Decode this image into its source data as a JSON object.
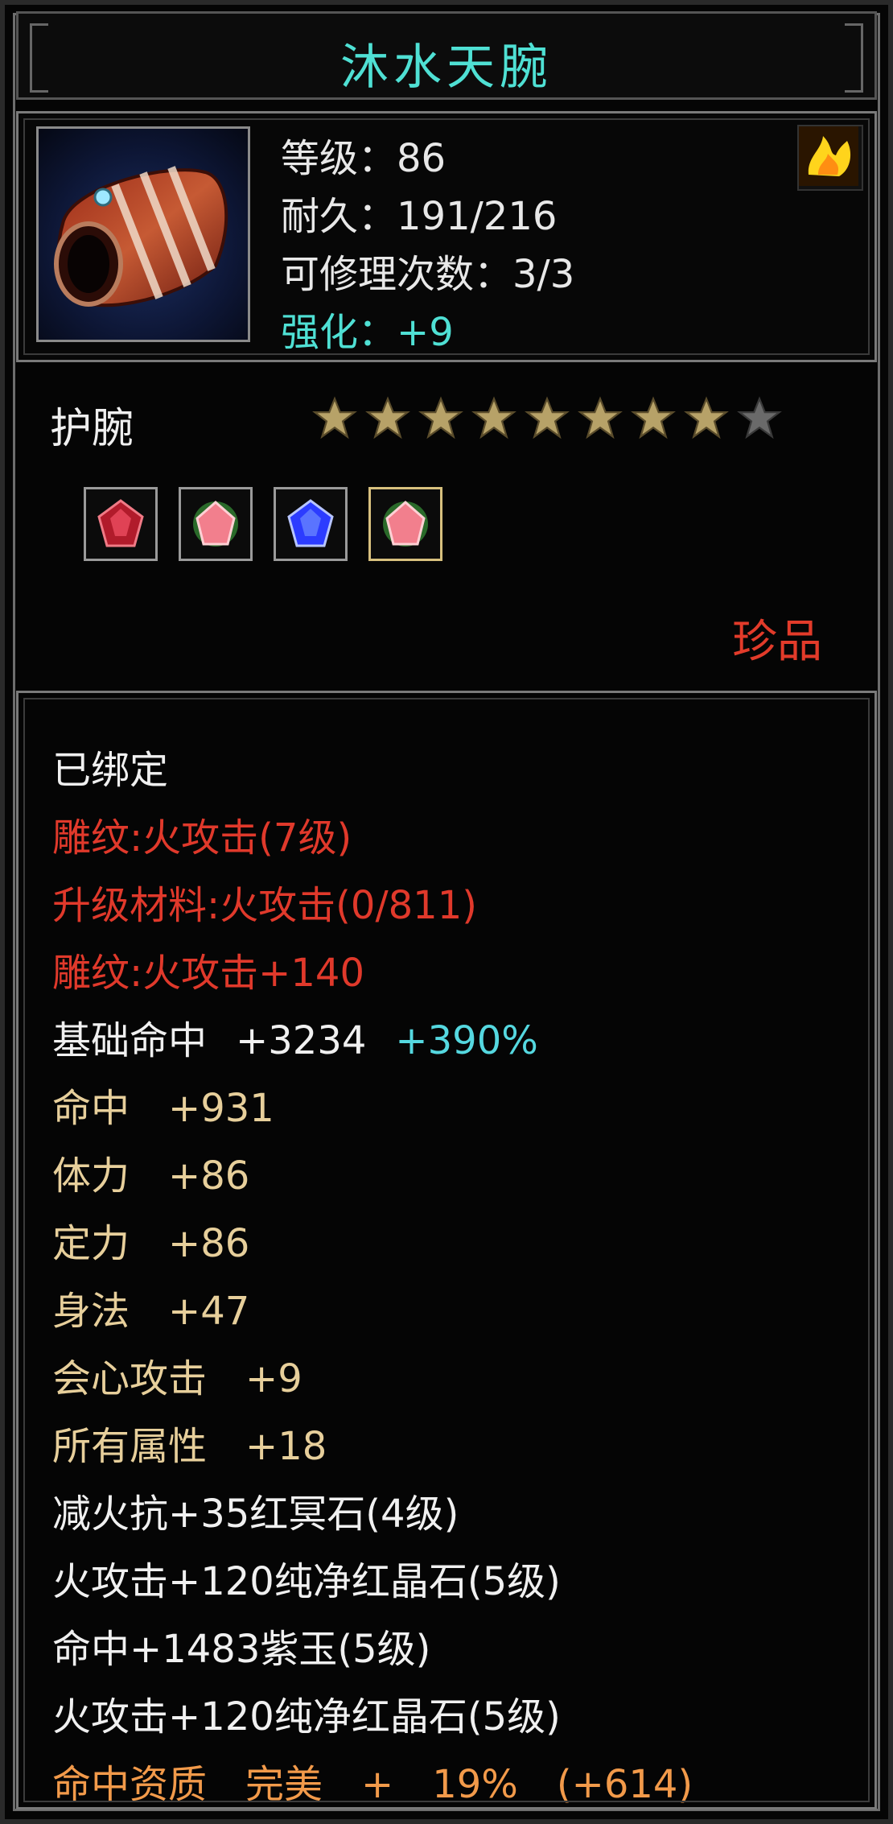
{
  "item": {
    "name": "沐水天腕",
    "level_line": "等级：86",
    "durability_line": "耐久：191/216",
    "repair_line": "可修理次数：3/3",
    "enhance_line": "强化：+9",
    "type": "护腕",
    "stars_total": 9,
    "stars_filled": 8,
    "rarity": "珍品"
  },
  "gems": [
    {
      "icon": "red-gem-icon"
    },
    {
      "icon": "pink-gem-icon"
    },
    {
      "icon": "blue-gem-icon"
    },
    {
      "icon": "pink-gem-icon"
    }
  ],
  "properties": {
    "bound": "已绑定",
    "engrave1": "雕纹:火攻击(7级)",
    "upgrade": "升级材料:火攻击(0/811)",
    "engrave2": "雕纹:火攻击+140",
    "base_hit_label": "基础命中",
    "base_hit_value": "+3234",
    "base_hit_pct": "+390%",
    "hit": "命中　+931",
    "stamina": "体力　+86",
    "focus": "定力　+86",
    "agility": "身法　+47",
    "crit": "会心攻击　+9",
    "all_attr": "所有属性　+18",
    "gem_line1": "减火抗+35红冥石(4级)",
    "gem_line2": "火攻击+120纯净红晶石(5级)",
    "gem_line3": "命中+1483紫玉(5级)",
    "gem_line4": "火攻击+120纯净红晶石(5级)",
    "quality": "命中资质　完美　+　19%　(+614)"
  },
  "colors": {
    "title": "#4fe0d4",
    "rarity": "#e23b2a",
    "red_text": "#e0392b",
    "gold_text": "#e7cf9b",
    "cyan_text": "#55d8e0",
    "orange_text": "#f29a4a",
    "star_filled": "#b7a268",
    "star_empty": "#6a6a6a"
  }
}
